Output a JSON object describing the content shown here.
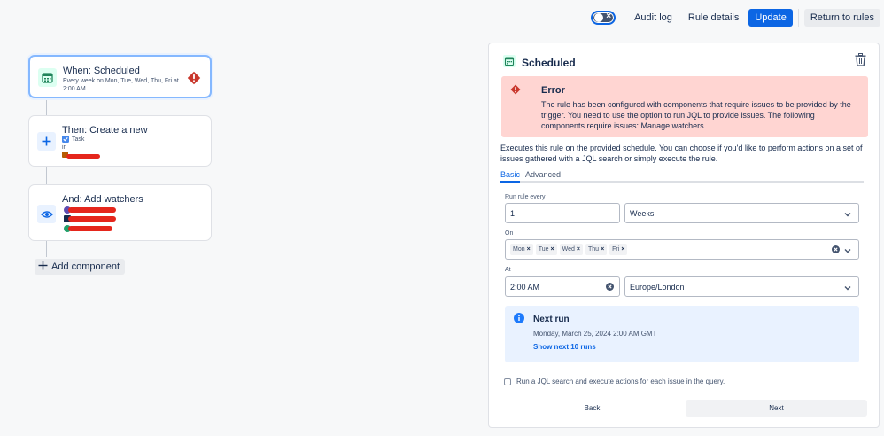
{
  "topbar": {
    "audit_log": "Audit log",
    "rule_details": "Rule details",
    "update": "Update",
    "return_to_rules": "Return to rules"
  },
  "flow": {
    "trigger": {
      "title": "When: Scheduled",
      "subtitle": "Every week on Mon, Tue, Wed, Thu, Fri at 2:00 AM"
    },
    "action": {
      "title": "Then: Create a new",
      "issue_type": "Task",
      "in_label": "in"
    },
    "watchers": {
      "title": "And: Add watchers"
    },
    "add_component": "Add component"
  },
  "panel": {
    "title": "Scheduled",
    "error": {
      "title": "Error",
      "body": "The rule has been configured with components that require issues to be provided by the trigger. You need to use the option to run JQL to provide issues. The following components require issues: Manage watchers"
    },
    "description": "Executes this rule on the provided schedule. You can choose if you'd like to perform actions on a set of issues gathered with a JQL search or simply execute the rule.",
    "tabs": {
      "basic": "Basic",
      "advanced": "Advanced"
    },
    "run_every_label": "Run rule every",
    "run_every_value": "1",
    "unit_value": "Weeks",
    "on_label": "On",
    "days": [
      "Mon",
      "Tue",
      "Wed",
      "Thu",
      "Fri"
    ],
    "at_label": "At",
    "time_value": "2:00 AM",
    "timezone_value": "Europe/London",
    "next_run": {
      "title": "Next run",
      "date": "Monday, March 25, 2024 2:00 AM GMT",
      "link": "Show next 10 runs"
    },
    "jql_checkbox": "Run a JQL search and execute actions for each issue in the query.",
    "back": "Back",
    "next": "Next"
  },
  "colors": {
    "primary": "#0c66e4",
    "error_bg": "#ffd5d2",
    "info_bg": "#e9f2ff",
    "error_icon": "#c9372c"
  }
}
